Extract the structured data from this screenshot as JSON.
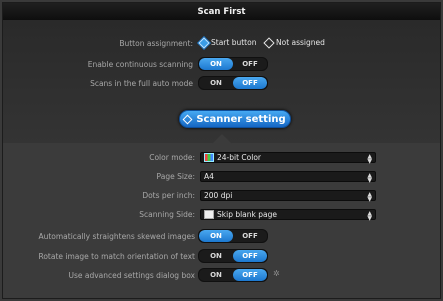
{
  "window": {
    "title": "Scan First"
  },
  "upper": {
    "button_assignment": {
      "label": "Button assignment:",
      "options": [
        {
          "label": "Start button",
          "selected": true
        },
        {
          "label": "Not assigned",
          "selected": false
        }
      ]
    },
    "continuous_scanning": {
      "label": "Enable continuous scanning",
      "on_label": "ON",
      "off_label": "OFF",
      "value": "ON"
    },
    "full_auto_mode": {
      "label": "Scans in the full auto mode",
      "on_label": "ON",
      "off_label": "OFF",
      "value": "OFF"
    }
  },
  "scanner_setting": {
    "label": "Scanner setting",
    "icon": "diamond-icon"
  },
  "settings": {
    "color_mode": {
      "label": "Color mode:",
      "value": "24-bit Color",
      "icon": "color-icon"
    },
    "page_size": {
      "label": "Page Size:",
      "value": "A4"
    },
    "dpi": {
      "label": "Dots per inch:",
      "value": "200 dpi"
    },
    "scanning_side": {
      "label": "Scanning Side:",
      "value": "Skip blank page",
      "icon": "page-icon"
    },
    "straighten": {
      "label": "Automatically straightens skewed images",
      "on_label": "ON",
      "off_label": "OFF",
      "value": "ON"
    },
    "rotate": {
      "label": "Rotate image to match orientation of text",
      "on_label": "ON",
      "off_label": "OFF",
      "value": "OFF"
    },
    "advanced": {
      "label": "Use advanced settings dialog box",
      "on_label": "ON",
      "off_label": "OFF",
      "value": "OFF",
      "icon": "gear-icon"
    }
  },
  "colors": {
    "accent": "#2a8ee0",
    "background": "#3a3a3a"
  }
}
